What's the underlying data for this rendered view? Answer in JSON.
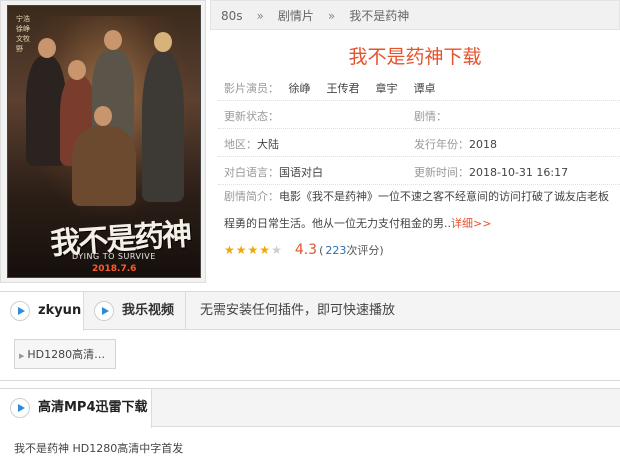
{
  "breadcrumb": {
    "home": "80s",
    "category": "剧情片",
    "current": "我不是药神",
    "sep": "»"
  },
  "movie": {
    "title": "我不是药神下载",
    "actors_label": "影片演员：",
    "actors": [
      "徐峥",
      "王传君",
      "章宇",
      "谭卓"
    ],
    "update_status_label": "更新状态：",
    "update_status": "",
    "genre_label": "剧情：",
    "genre": "",
    "region_label": "地区：",
    "region": "大陆",
    "year_label": "发行年份：",
    "year": "2018",
    "language_label": "对白语言：",
    "language": "国语对白",
    "updated_label": "更新时间：",
    "updated": "2018-10-31 16:17",
    "synopsis_label": "剧情简介：",
    "synopsis": "电影《我不是药神》一位不速之客不经意间的访问打破了诚友店老板程勇的日常生活。他从一位无力支付租金的男..",
    "more_link": "详细>>",
    "rating_stars": 4,
    "rating_max": 5,
    "score": "4.3",
    "votes_prefix": "(",
    "votes": "223",
    "votes_suffix": "次评分)"
  },
  "poster": {
    "credits": "宁浩 徐峥 文牧野",
    "logo": "我不是药神",
    "english": "DYING TO SURVIVE",
    "date": "2018.7.6"
  },
  "player_tabs": [
    {
      "label": "zkyun",
      "active": true
    },
    {
      "label": "我乐视频",
      "active": false
    }
  ],
  "player_note": "无需安装任何插件，即可快速播放",
  "episode": "HD1280高清…",
  "download": {
    "tab_label": "高清MP4迅雷下载",
    "item": "我不是药神 HD1280高清中字首发"
  },
  "colors": {
    "accent": "#e4532c",
    "star": "#f2a60c",
    "play": "#2f8ad8"
  }
}
